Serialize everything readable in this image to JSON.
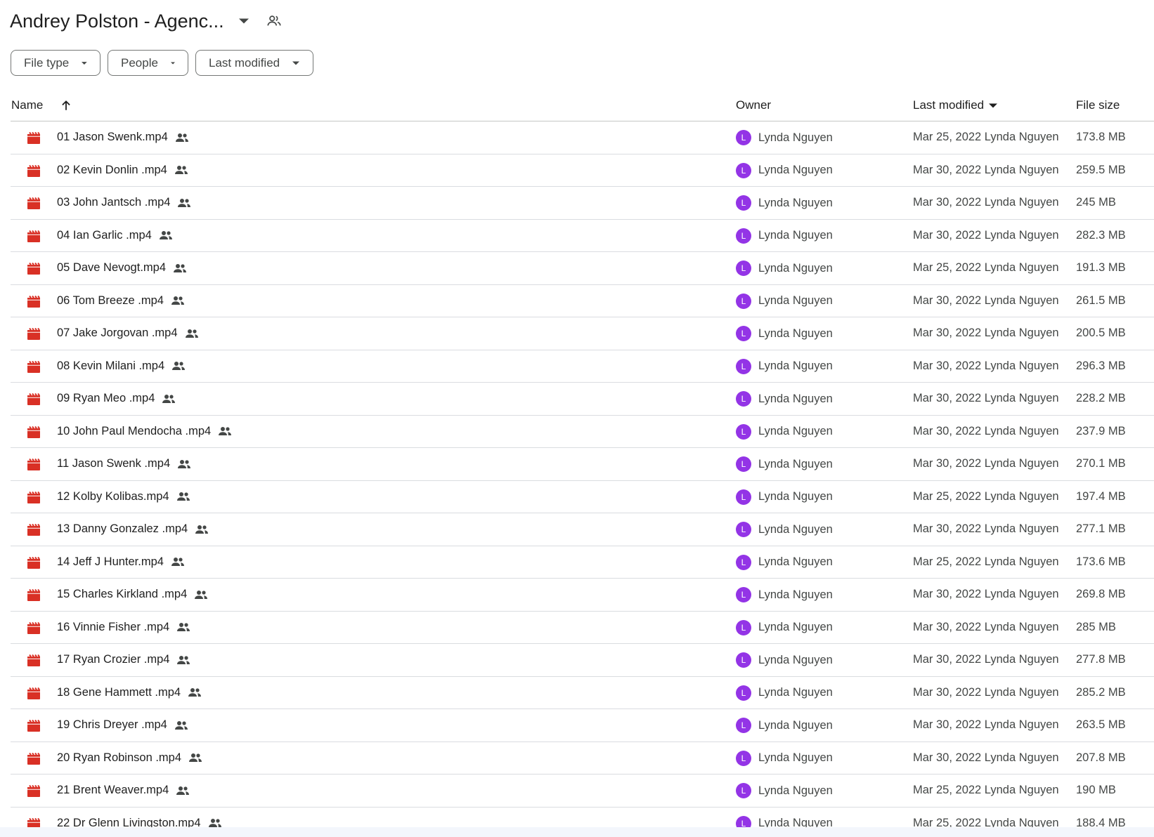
{
  "header": {
    "title": "Andrey Polston - Agenc...",
    "caret_icon": "arrow-drop-down-icon",
    "shared_icon": "shared-folder-people-icon"
  },
  "filters": {
    "file_type": "File type",
    "people": "People",
    "last_modified": "Last modified"
  },
  "columns": {
    "name": "Name",
    "owner": "Owner",
    "last_modified": "Last modified",
    "file_size": "File size"
  },
  "colors": {
    "video_icon": "#d93025",
    "avatar": "#9334e6",
    "divider": "#dadce0"
  },
  "files": [
    {
      "name": "01 Jason Swenk.mp4",
      "owner": "Lynda Nguyen",
      "avatar": "L",
      "modified": "Mar 25, 2022 Lynda Nguyen",
      "size": "173.8 MB"
    },
    {
      "name": "02 Kevin Donlin .mp4",
      "owner": "Lynda Nguyen",
      "avatar": "L",
      "modified": "Mar 30, 2022 Lynda Nguyen",
      "size": "259.5 MB"
    },
    {
      "name": "03 John Jantsch .mp4",
      "owner": "Lynda Nguyen",
      "avatar": "L",
      "modified": "Mar 30, 2022 Lynda Nguyen",
      "size": "245 MB"
    },
    {
      "name": "04 Ian Garlic .mp4",
      "owner": "Lynda Nguyen",
      "avatar": "L",
      "modified": "Mar 30, 2022 Lynda Nguyen",
      "size": "282.3 MB"
    },
    {
      "name": "05 Dave Nevogt.mp4",
      "owner": "Lynda Nguyen",
      "avatar": "L",
      "modified": "Mar 25, 2022 Lynda Nguyen",
      "size": "191.3 MB"
    },
    {
      "name": "06 Tom Breeze .mp4",
      "owner": "Lynda Nguyen",
      "avatar": "L",
      "modified": "Mar 30, 2022 Lynda Nguyen",
      "size": "261.5 MB"
    },
    {
      "name": "07 Jake Jorgovan .mp4",
      "owner": "Lynda Nguyen",
      "avatar": "L",
      "modified": "Mar 30, 2022 Lynda Nguyen",
      "size": "200.5 MB"
    },
    {
      "name": "08 Kevin Milani .mp4",
      "owner": "Lynda Nguyen",
      "avatar": "L",
      "modified": "Mar 30, 2022 Lynda Nguyen",
      "size": "296.3 MB"
    },
    {
      "name": "09 Ryan Meo .mp4",
      "owner": "Lynda Nguyen",
      "avatar": "L",
      "modified": "Mar 30, 2022 Lynda Nguyen",
      "size": "228.2 MB"
    },
    {
      "name": "10 John Paul Mendocha .mp4",
      "owner": "Lynda Nguyen",
      "avatar": "L",
      "modified": "Mar 30, 2022 Lynda Nguyen",
      "size": "237.9 MB"
    },
    {
      "name": "11 Jason Swenk .mp4",
      "owner": "Lynda Nguyen",
      "avatar": "L",
      "modified": "Mar 30, 2022 Lynda Nguyen",
      "size": "270.1 MB"
    },
    {
      "name": "12 Kolby Kolibas.mp4",
      "owner": "Lynda Nguyen",
      "avatar": "L",
      "modified": "Mar 25, 2022 Lynda Nguyen",
      "size": "197.4 MB"
    },
    {
      "name": "13 Danny Gonzalez .mp4",
      "owner": "Lynda Nguyen",
      "avatar": "L",
      "modified": "Mar 30, 2022 Lynda Nguyen",
      "size": "277.1 MB"
    },
    {
      "name": "14 Jeff J Hunter.mp4",
      "owner": "Lynda Nguyen",
      "avatar": "L",
      "modified": "Mar 25, 2022 Lynda Nguyen",
      "size": "173.6 MB"
    },
    {
      "name": "15 Charles Kirkland .mp4",
      "owner": "Lynda Nguyen",
      "avatar": "L",
      "modified": "Mar 30, 2022 Lynda Nguyen",
      "size": "269.8 MB"
    },
    {
      "name": "16 Vinnie Fisher .mp4",
      "owner": "Lynda Nguyen",
      "avatar": "L",
      "modified": "Mar 30, 2022 Lynda Nguyen",
      "size": "285 MB"
    },
    {
      "name": "17 Ryan Crozier .mp4",
      "owner": "Lynda Nguyen",
      "avatar": "L",
      "modified": "Mar 30, 2022 Lynda Nguyen",
      "size": "277.8 MB"
    },
    {
      "name": "18 Gene Hammett .mp4",
      "owner": "Lynda Nguyen",
      "avatar": "L",
      "modified": "Mar 30, 2022 Lynda Nguyen",
      "size": "285.2 MB"
    },
    {
      "name": "19 Chris Dreyer .mp4",
      "owner": "Lynda Nguyen",
      "avatar": "L",
      "modified": "Mar 30, 2022 Lynda Nguyen",
      "size": "263.5 MB"
    },
    {
      "name": "20 Ryan Robinson .mp4",
      "owner": "Lynda Nguyen",
      "avatar": "L",
      "modified": "Mar 30, 2022 Lynda Nguyen",
      "size": "207.8 MB"
    },
    {
      "name": "21 Brent Weaver.mp4",
      "owner": "Lynda Nguyen",
      "avatar": "L",
      "modified": "Mar 25, 2022 Lynda Nguyen",
      "size": "190 MB"
    },
    {
      "name": "22 Dr Glenn Livingston.mp4",
      "owner": "Lynda Nguyen",
      "avatar": "L",
      "modified": "Mar 25, 2022 Lynda Nguyen",
      "size": "188.4 MB"
    }
  ]
}
